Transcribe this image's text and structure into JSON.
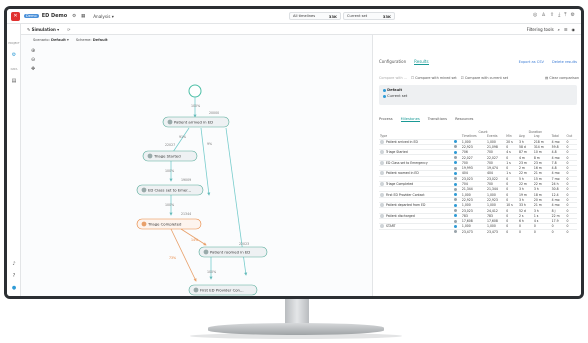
{
  "app": {
    "title": "ED Demo",
    "tag": "Demo",
    "menu": "Analysis"
  },
  "counts": [
    {
      "label": "All timelines",
      "value": "33K"
    },
    {
      "label": "Current set",
      "value": "33K"
    }
  ],
  "toolbar": {
    "mode": "Simulation",
    "filtering_tools": "Filtering tools"
  },
  "rail": {
    "labels": [
      "PROJECT",
      "DATA"
    ]
  },
  "scenario": {
    "scenario_label": "Scenario",
    "scenario_value": "Default",
    "scheme_label": "Scheme",
    "scheme_value": "Default"
  },
  "graph": {
    "nodes": [
      {
        "label": "Patient arrived in ED",
        "highlight": false
      },
      {
        "label": "Triage Started",
        "highlight": false
      },
      {
        "label": "ED Class set to Emer...",
        "highlight": false
      },
      {
        "label": "Triage Completed",
        "highlight": true
      },
      {
        "label": "Patient roomed in ED",
        "highlight": false
      },
      {
        "label": "First ED Provider Con...",
        "highlight": false
      }
    ],
    "edge_labels": [
      "100%",
      "20000",
      "91%",
      "100%",
      "22027",
      "9%",
      "100%",
      "19009",
      "100%",
      "21344",
      "73%",
      "14%",
      "22023",
      "87%",
      "100%",
      "24%",
      "100%"
    ]
  },
  "panel": {
    "tabs": [
      "Configuration",
      "Results"
    ],
    "active_tab": "Results",
    "actions": [
      "Export as CSV",
      "Delete results"
    ],
    "compare_hint": "Compare with ...",
    "compare_opts": [
      "Compare with mined set",
      "Compare with current set"
    ],
    "clear": "Clear comparison",
    "info_title": "Default",
    "info_sub": "Current set",
    "subtabs": [
      "Process",
      "Milestones",
      "Transitions",
      "Resources"
    ],
    "active_subtab": "Milestones",
    "group_headers": [
      "Count",
      "Duration"
    ],
    "columns": [
      "Type",
      "",
      "Timelines",
      "Events",
      "Min",
      "Avg",
      "Lng",
      "Total",
      "Out"
    ],
    "rows": [
      {
        "type": "Patient arrived in ED",
        "a": [
          "1,000",
          "1,000",
          "20 s",
          "3 h",
          "218 m",
          "4 mo",
          "0"
        ],
        "b": [
          "22,923",
          "21,098",
          "0",
          "58 d",
          "314 m",
          "59.8",
          "0"
        ]
      },
      {
        "type": "Triage Started",
        "a": [
          "706",
          "700",
          "4 s",
          "87 m",
          "10 m",
          "4.8",
          "0"
        ],
        "b": [
          "22,027",
          "22,027",
          "0",
          "4 m",
          "8 m",
          "4 mo",
          "0"
        ]
      },
      {
        "type": "ED Class set to Emergency",
        "a": [
          "700",
          "700",
          "1 s",
          "23 m",
          "23 m",
          "7.8",
          "0"
        ],
        "b": [
          "19,993",
          "19,474",
          "0",
          "2 m",
          "16 m",
          "4.8",
          "0"
        ]
      },
      {
        "type": "Patient roomed in ED",
        "a": [
          "404",
          "404",
          "1 s",
          "22 m",
          "21 m",
          "4 mo",
          "0"
        ],
        "b": [
          "23,023",
          "23,022",
          "0",
          "5 h",
          "15 m",
          "7 mo",
          "0"
        ]
      },
      {
        "type": "Triage Completed",
        "a": [
          "704",
          "700",
          "0",
          "22 m",
          "22 m",
          "24 h",
          "0"
        ],
        "b": [
          "21,344",
          "21,344",
          "0",
          "3 h",
          "3 h",
          "30.8",
          "0"
        ]
      },
      {
        "type": "First ED Provider Contact",
        "a": [
          "1,000",
          "1,000",
          "0",
          "19 m",
          "18 m",
          "12.4",
          "0"
        ],
        "b": [
          "22,923",
          "22,923",
          "0",
          "3 h",
          "20 m",
          "4 mo",
          "0"
        ]
      },
      {
        "type": "Patient departed from ED",
        "a": [
          "1,000",
          "1,000",
          "10 s",
          "33 h",
          "21 m",
          "4 mo",
          "0"
        ],
        "b": [
          "23,023",
          "24,412",
          "0",
          "52 d",
          "3 h",
          "8 j",
          "0"
        ]
      },
      {
        "type": "Patient discharged",
        "a": [
          "783",
          "783",
          "0",
          "2 s",
          "1 s",
          "22 m",
          "0"
        ],
        "b": [
          "17,608",
          "17,608",
          "0",
          "6 h",
          "4 s",
          "17.9",
          "0"
        ]
      },
      {
        "type": "START",
        "a": [
          "1,000",
          "1,000",
          "0",
          "0",
          "0",
          "0",
          "0"
        ],
        "b": [
          "23,473",
          "23,473",
          "0",
          "0",
          "0",
          "0",
          "0"
        ]
      }
    ]
  }
}
